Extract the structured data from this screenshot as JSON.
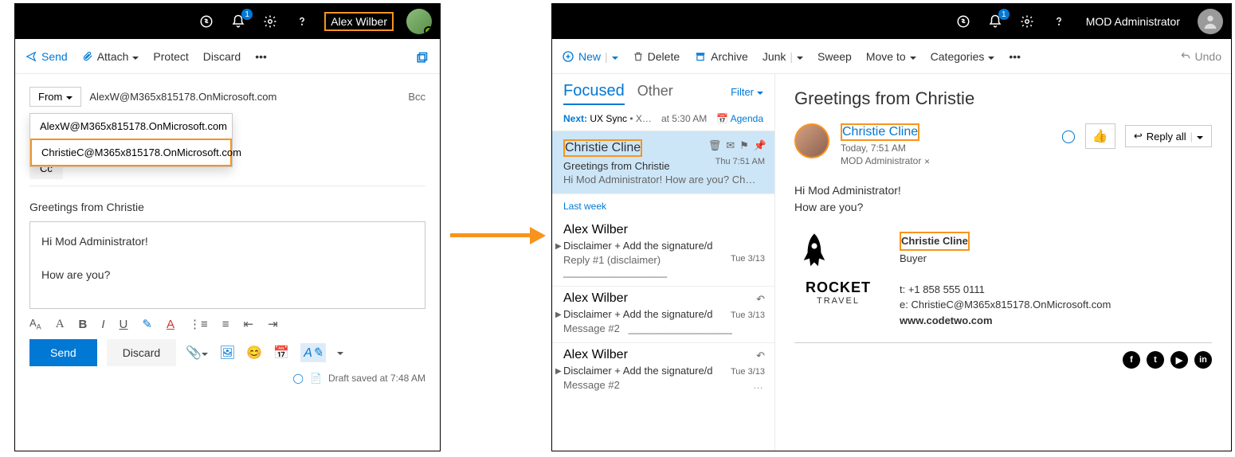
{
  "left": {
    "topbar": {
      "badge": "1",
      "user": "Alex Wilber"
    },
    "cmdbar": {
      "send": "Send",
      "attach": "Attach",
      "protect": "Protect",
      "discard": "Discard"
    },
    "from_label": "From",
    "from_value": "AlexW@M365x815178.OnMicrosoft.com",
    "bcc": "Bcc",
    "from_options": [
      "AlexW@M365x815178.OnMicrosoft.com",
      "ChristieC@M365x815178.OnMicrosoft.com"
    ],
    "cc": "Cc",
    "subject": "Greetings from Christie",
    "body_line1": "Hi Mod Administrator!",
    "body_line2": "How are you?",
    "send_btn": "Send",
    "discard_btn": "Discard",
    "draft_status": "Draft saved at 7:48 AM"
  },
  "right": {
    "topbar": {
      "badge": "1",
      "user": "MOD Administrator"
    },
    "cmdbar": {
      "new": "New",
      "delete": "Delete",
      "archive": "Archive",
      "junk": "Junk",
      "sweep": "Sweep",
      "moveto": "Move to",
      "categories": "Categories",
      "undo": "Undo"
    },
    "tabs": {
      "focused": "Focused",
      "other": "Other",
      "filter": "Filter"
    },
    "next": {
      "label": "Next:",
      "event": "UX Sync",
      "extra": "• X…",
      "time": "at 5:30 AM",
      "agenda": "Agenda"
    },
    "selected_msg": {
      "sender": "Christie Cline",
      "subject": "Greetings from Christie",
      "preview": "Hi Mod Administrator!   How are you?  Ch…",
      "time": "Thu 7:51 AM"
    },
    "section": "Last week",
    "convs": [
      {
        "sender": "Alex Wilber",
        "subj": "Disclaimer + Add the signature/d",
        "reply": "Reply #1 (disclaimer)",
        "time": "Tue 3/13"
      },
      {
        "sender": "Alex Wilber",
        "subj": "Disclaimer + Add the signature/d",
        "reply": "Message #2",
        "time": "Tue 3/13"
      },
      {
        "sender": "Alex Wilber",
        "subj": "Disclaimer + Add the signature/d",
        "reply": "Message #2",
        "time": "Tue 3/13"
      }
    ],
    "reading": {
      "title": "Greetings from Christie",
      "sender": "Christie Cline",
      "sent": "Today, 7:51 AM",
      "to": "MOD Administrator",
      "reply_all": "Reply all",
      "body_line1": "Hi Mod Administrator!",
      "body_line2": "How are you?",
      "sig_name": "Christie Cline",
      "sig_role": "Buyer",
      "sig_phone": "t: +1 858 555 0111",
      "sig_email": "e: ChristieC@M365x815178.OnMicrosoft.com",
      "sig_web": "www.codetwo.com",
      "brand": "ROCKET",
      "brand_sub": "TRAVEL"
    }
  }
}
